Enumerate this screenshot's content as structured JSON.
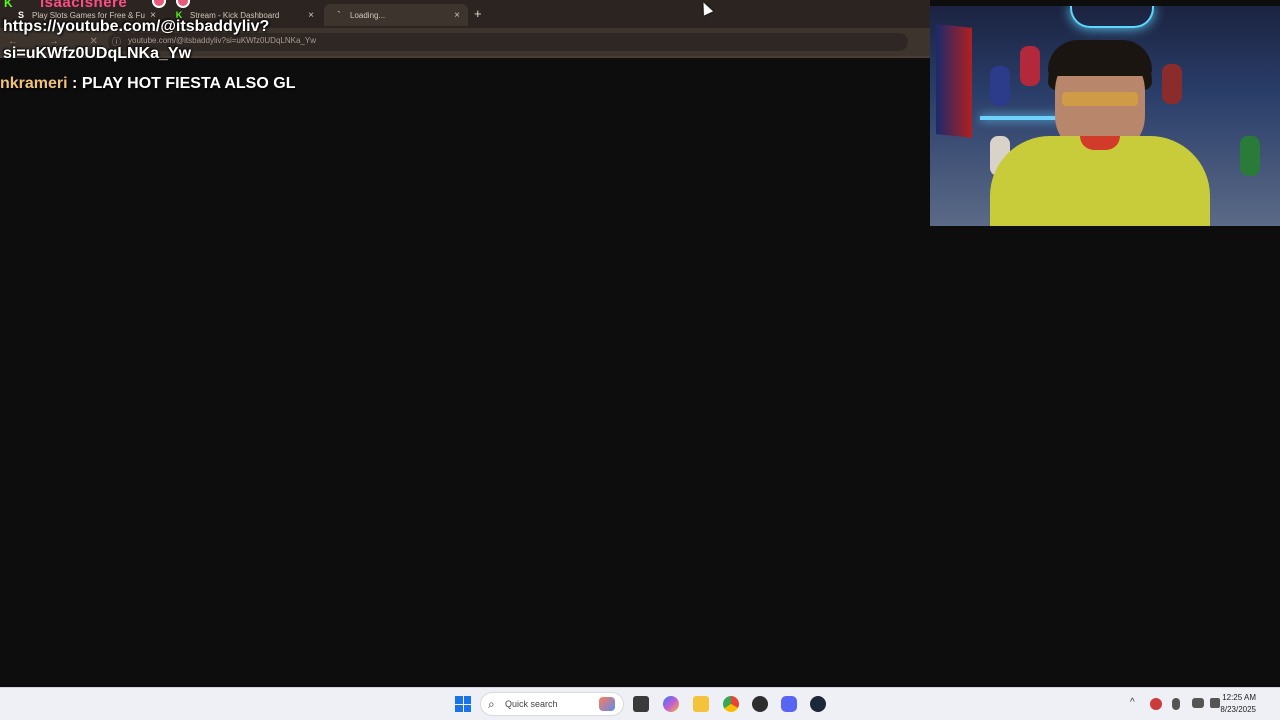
{
  "browser": {
    "tabs": [
      {
        "label": "Play Slots Games for Free & Fu",
        "favicon": "S"
      },
      {
        "label": "Stream - Kick Dashboard",
        "favicon": "K"
      },
      {
        "label": "Loading...",
        "favicon": "`"
      }
    ],
    "close_glyph": "×",
    "new_tab_glyph": "+",
    "nav_glyphs": "← → ✕ ⌂",
    "info_glyph": "ⓘ",
    "url": "youtube.com/@itsbaddyliv?si=uKWfz0UDqLNKa_Yw"
  },
  "overlay": {
    "logo": "K",
    "username": "isaacishere",
    "link_line1": "https://youtube.com/@itsbaddyliv?",
    "link_line2": "si=uKWfz0UDqLNKa_Yw",
    "chat_user": "nkrameri",
    "chat_sep": " : ",
    "chat_text": "PLAY HOT FIESTA ALSO GL"
  },
  "taskbar": {
    "search_placeholder": "Quick search",
    "search_icon": "⌕",
    "tray_chevron": "^",
    "time": "12:25 AM",
    "date": "8/23/2025"
  },
  "colors": {
    "tab_bg": "#2b2420",
    "toolbar_bg": "#3d342e",
    "overlay_username": "#ff4d88",
    "chat_user": "#f0c27a",
    "kick_green": "#53fc18",
    "taskbar_bg": "#eef0f5"
  }
}
